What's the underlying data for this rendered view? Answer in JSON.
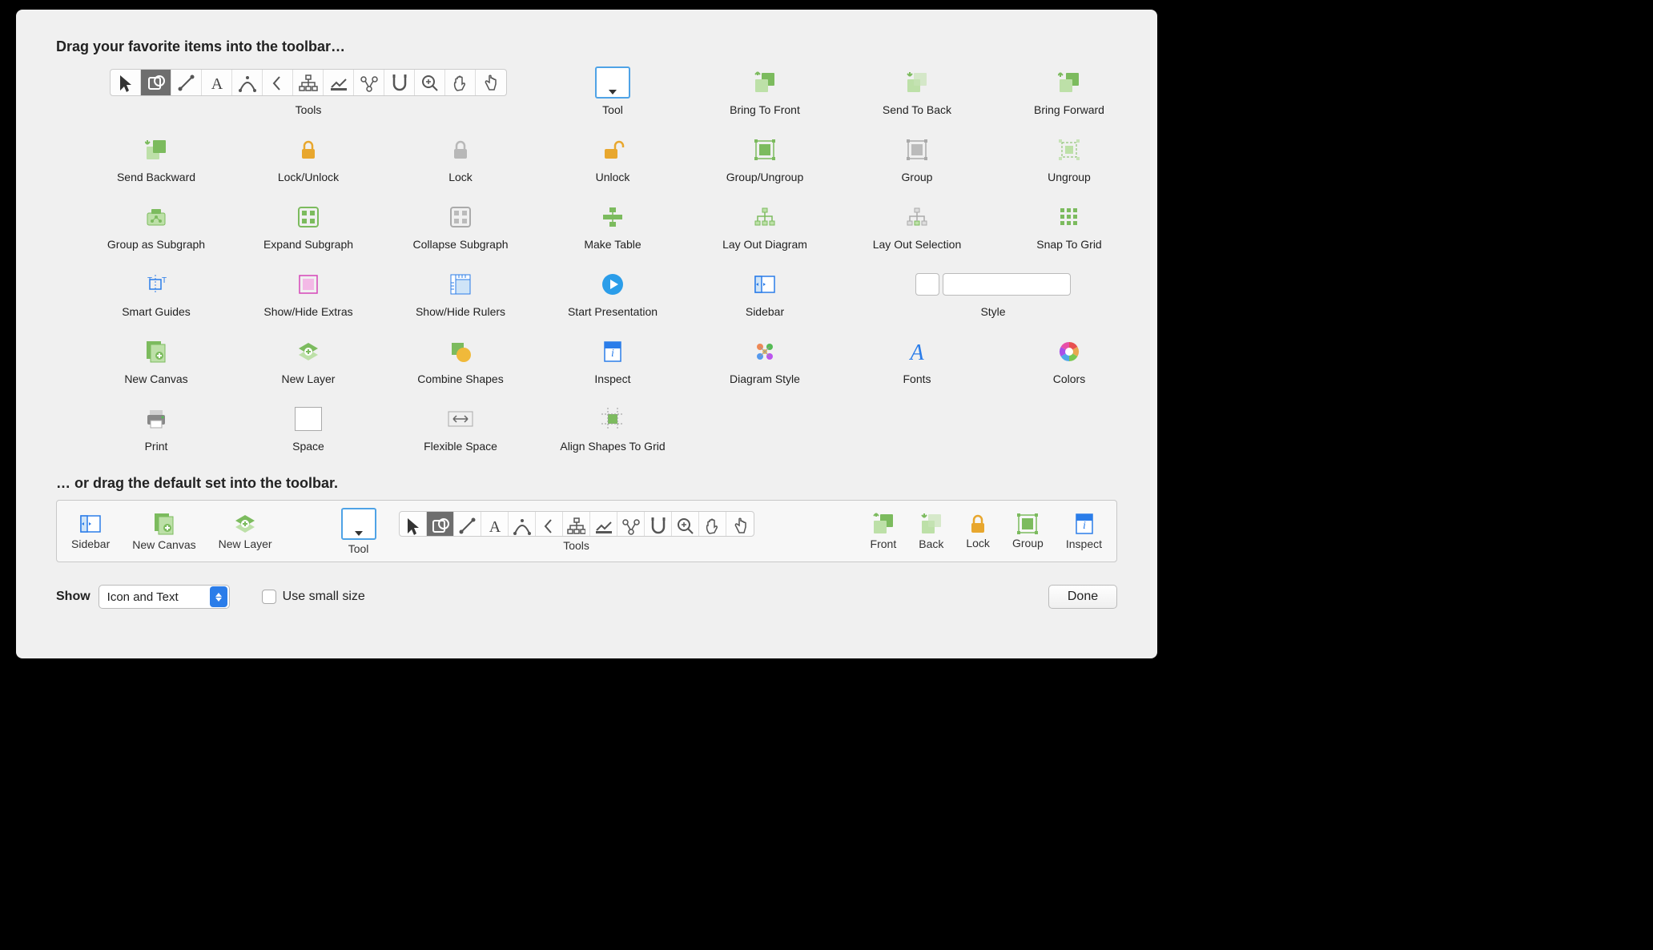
{
  "heading": "Drag your favorite items into the toolbar…",
  "items": {
    "tools": "Tools",
    "tool": "Tool",
    "bring_to_front": "Bring To Front",
    "send_to_back": "Send To Back",
    "bring_forward": "Bring Forward",
    "send_backward": "Send Backward",
    "lock_unlock": "Lock/Unlock",
    "lock": "Lock",
    "unlock": "Unlock",
    "group_ungroup": "Group/Ungroup",
    "group": "Group",
    "ungroup": "Ungroup",
    "group_as_subgraph": "Group as Subgraph",
    "expand_subgraph": "Expand Subgraph",
    "collapse_subgraph": "Collapse Subgraph",
    "make_table": "Make Table",
    "lay_out_diagram": "Lay Out Diagram",
    "lay_out_selection": "Lay Out Selection",
    "snap_to_grid": "Snap To Grid",
    "smart_guides": "Smart Guides",
    "show_hide_extras": "Show/Hide Extras",
    "show_hide_rulers": "Show/Hide Rulers",
    "start_presentation": "Start Presentation",
    "sidebar": "Sidebar",
    "style": "Style",
    "new_canvas": "New Canvas",
    "new_layer": "New Layer",
    "combine_shapes": "Combine Shapes",
    "inspect": "Inspect",
    "diagram_style": "Diagram Style",
    "fonts": "Fonts",
    "colors": "Colors",
    "print": "Print",
    "space": "Space",
    "flexible_space": "Flexible Space",
    "align_shapes_to_grid": "Align Shapes To Grid"
  },
  "default_heading": "… or drag the default set into the toolbar.",
  "default_set": {
    "sidebar": "Sidebar",
    "new_canvas": "New Canvas",
    "new_layer": "New Layer",
    "tool": "Tool",
    "tools": "Tools",
    "front": "Front",
    "back": "Back",
    "lock": "Lock",
    "group": "Group",
    "inspect": "Inspect"
  },
  "bottom": {
    "show_label": "Show",
    "show_value": "Icon and Text",
    "small_size_label": "Use small size",
    "done": "Done"
  }
}
